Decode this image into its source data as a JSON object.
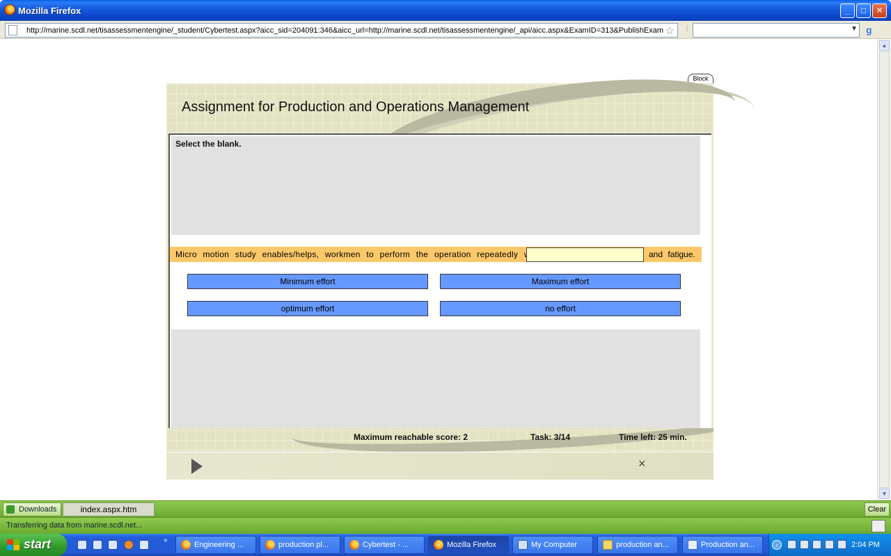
{
  "window": {
    "title": "Mozilla Firefox",
    "url": "http://marine.scdl.net/tisassessmentengine/_student/Cybertest.aspx?aicc_sid=204091:346&aicc_url=http://marine.scdl.net/tisassessmentengine/_api/aicc.aspx&ExamID=313&PublishExam"
  },
  "exam": {
    "block_label": "Block",
    "title": "Assignment for Production and Operations Management",
    "instruction": "Select the blank.",
    "question_before": "Micro motion study enables/helps, workmen to perform the operation repeatedly with",
    "question_after": "and fatigue.",
    "blank_value": "",
    "options": [
      "Minimum effort",
      "Maximum effort",
      "optimum effort",
      "no effort"
    ],
    "max_score": "Maximum reachable score: 2",
    "task": "Task: 3/14",
    "time_left": "Time left: 25 min.",
    "close_glyph": "×"
  },
  "downloads": {
    "button_label": "Downloads",
    "item": "index.aspx.htm",
    "clear_label": "Clear"
  },
  "status": {
    "text": "Transferring data from marine.scdl.net..."
  },
  "taskbar": {
    "start_label": "start",
    "tasks": [
      "Engineering ...",
      "production pl...",
      "Cybertest - ...",
      "Mozilla Firefox",
      "My Computer",
      "production an...",
      "Production an..."
    ],
    "clock": "2:04 PM"
  }
}
